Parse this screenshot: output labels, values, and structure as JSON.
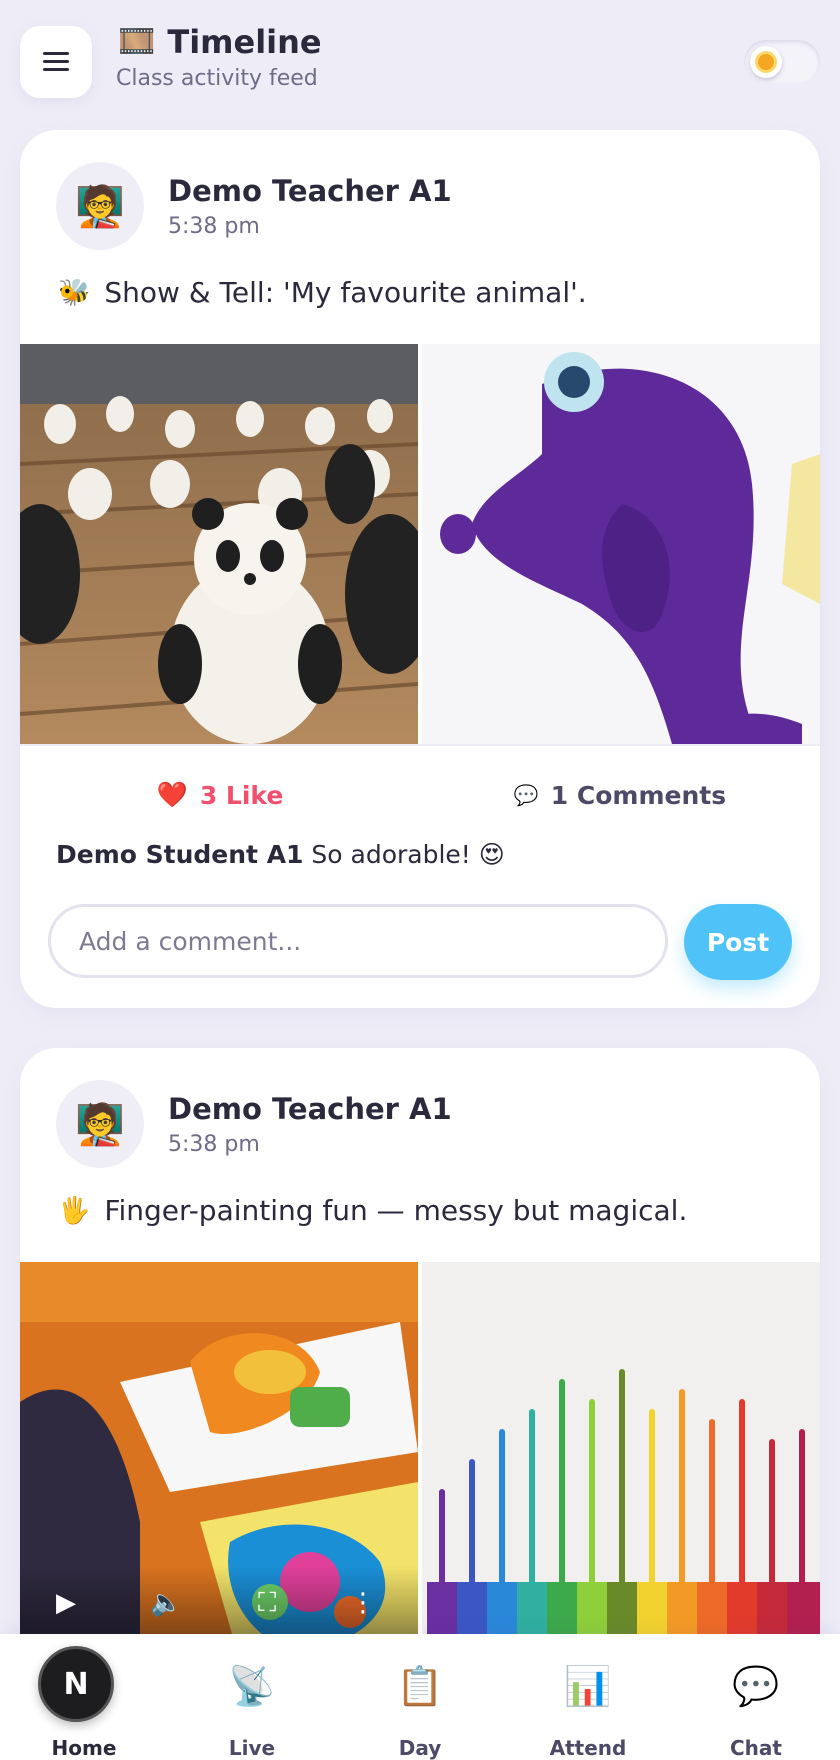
{
  "header": {
    "menu_icon": "hamburger-menu-icon",
    "title_icon": "🎞️",
    "title": "Timeline",
    "subtitle": "Class activity feed",
    "theme_toggle_icon": "sun-icon"
  },
  "posts": [
    {
      "author": "Demo Teacher A1",
      "avatar": "🧑‍🏫",
      "time": "5:38 pm",
      "caption_emoji": "🐝",
      "caption": "Show & Tell: 'My favourite animal'.",
      "media": [
        "panda-figurines-photo",
        "purple-seahorse-plush-photo"
      ],
      "likes": "3 Like",
      "comments": "1 Comments",
      "latest_comment": {
        "author": "Demo Student A1",
        "text": "So adorable! 😍"
      },
      "comment_placeholder": "Add a comment...",
      "post_label": "Post"
    },
    {
      "author": "Demo Teacher A1",
      "avatar": "🧑‍🏫",
      "time": "5:38 pm",
      "caption_emoji": "🖐️",
      "caption": "Finger-painting fun — messy but magical.",
      "media": [
        "child-painting-video",
        "melted-crayon-art-photo"
      ]
    }
  ],
  "nav": [
    {
      "label": "Home",
      "icon": "N",
      "active": true
    },
    {
      "label": "Live",
      "icon": "📡"
    },
    {
      "label": "Day",
      "icon": "📋"
    },
    {
      "label": "Attend",
      "icon": "📊"
    },
    {
      "label": "Chat",
      "icon": "💬"
    }
  ],
  "colors": {
    "accent": "#4fc3f7",
    "like": "#f0506e",
    "background": "#eeedf7"
  }
}
